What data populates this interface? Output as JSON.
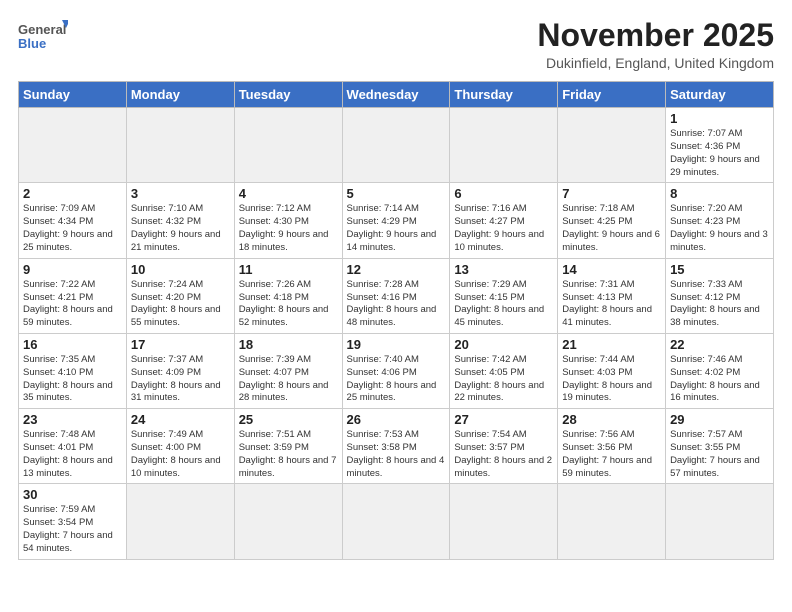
{
  "logo": {
    "line1": "General",
    "line2": "Blue"
  },
  "header": {
    "month": "November 2025",
    "location": "Dukinfield, England, United Kingdom"
  },
  "weekdays": [
    "Sunday",
    "Monday",
    "Tuesday",
    "Wednesday",
    "Thursday",
    "Friday",
    "Saturday"
  ],
  "weeks": [
    [
      {
        "day": "",
        "info": ""
      },
      {
        "day": "",
        "info": ""
      },
      {
        "day": "",
        "info": ""
      },
      {
        "day": "",
        "info": ""
      },
      {
        "day": "",
        "info": ""
      },
      {
        "day": "",
        "info": ""
      },
      {
        "day": "1",
        "info": "Sunrise: 7:07 AM\nSunset: 4:36 PM\nDaylight: 9 hours\nand 29 minutes."
      }
    ],
    [
      {
        "day": "2",
        "info": "Sunrise: 7:09 AM\nSunset: 4:34 PM\nDaylight: 9 hours\nand 25 minutes."
      },
      {
        "day": "3",
        "info": "Sunrise: 7:10 AM\nSunset: 4:32 PM\nDaylight: 9 hours\nand 21 minutes."
      },
      {
        "day": "4",
        "info": "Sunrise: 7:12 AM\nSunset: 4:30 PM\nDaylight: 9 hours\nand 18 minutes."
      },
      {
        "day": "5",
        "info": "Sunrise: 7:14 AM\nSunset: 4:29 PM\nDaylight: 9 hours\nand 14 minutes."
      },
      {
        "day": "6",
        "info": "Sunrise: 7:16 AM\nSunset: 4:27 PM\nDaylight: 9 hours\nand 10 minutes."
      },
      {
        "day": "7",
        "info": "Sunrise: 7:18 AM\nSunset: 4:25 PM\nDaylight: 9 hours\nand 6 minutes."
      },
      {
        "day": "8",
        "info": "Sunrise: 7:20 AM\nSunset: 4:23 PM\nDaylight: 9 hours\nand 3 minutes."
      }
    ],
    [
      {
        "day": "9",
        "info": "Sunrise: 7:22 AM\nSunset: 4:21 PM\nDaylight: 8 hours\nand 59 minutes."
      },
      {
        "day": "10",
        "info": "Sunrise: 7:24 AM\nSunset: 4:20 PM\nDaylight: 8 hours\nand 55 minutes."
      },
      {
        "day": "11",
        "info": "Sunrise: 7:26 AM\nSunset: 4:18 PM\nDaylight: 8 hours\nand 52 minutes."
      },
      {
        "day": "12",
        "info": "Sunrise: 7:28 AM\nSunset: 4:16 PM\nDaylight: 8 hours\nand 48 minutes."
      },
      {
        "day": "13",
        "info": "Sunrise: 7:29 AM\nSunset: 4:15 PM\nDaylight: 8 hours\nand 45 minutes."
      },
      {
        "day": "14",
        "info": "Sunrise: 7:31 AM\nSunset: 4:13 PM\nDaylight: 8 hours\nand 41 minutes."
      },
      {
        "day": "15",
        "info": "Sunrise: 7:33 AM\nSunset: 4:12 PM\nDaylight: 8 hours\nand 38 minutes."
      }
    ],
    [
      {
        "day": "16",
        "info": "Sunrise: 7:35 AM\nSunset: 4:10 PM\nDaylight: 8 hours\nand 35 minutes."
      },
      {
        "day": "17",
        "info": "Sunrise: 7:37 AM\nSunset: 4:09 PM\nDaylight: 8 hours\nand 31 minutes."
      },
      {
        "day": "18",
        "info": "Sunrise: 7:39 AM\nSunset: 4:07 PM\nDaylight: 8 hours\nand 28 minutes."
      },
      {
        "day": "19",
        "info": "Sunrise: 7:40 AM\nSunset: 4:06 PM\nDaylight: 8 hours\nand 25 minutes."
      },
      {
        "day": "20",
        "info": "Sunrise: 7:42 AM\nSunset: 4:05 PM\nDaylight: 8 hours\nand 22 minutes."
      },
      {
        "day": "21",
        "info": "Sunrise: 7:44 AM\nSunset: 4:03 PM\nDaylight: 8 hours\nand 19 minutes."
      },
      {
        "day": "22",
        "info": "Sunrise: 7:46 AM\nSunset: 4:02 PM\nDaylight: 8 hours\nand 16 minutes."
      }
    ],
    [
      {
        "day": "23",
        "info": "Sunrise: 7:48 AM\nSunset: 4:01 PM\nDaylight: 8 hours\nand 13 minutes."
      },
      {
        "day": "24",
        "info": "Sunrise: 7:49 AM\nSunset: 4:00 PM\nDaylight: 8 hours\nand 10 minutes."
      },
      {
        "day": "25",
        "info": "Sunrise: 7:51 AM\nSunset: 3:59 PM\nDaylight: 8 hours\nand 7 minutes."
      },
      {
        "day": "26",
        "info": "Sunrise: 7:53 AM\nSunset: 3:58 PM\nDaylight: 8 hours\nand 4 minutes."
      },
      {
        "day": "27",
        "info": "Sunrise: 7:54 AM\nSunset: 3:57 PM\nDaylight: 8 hours\nand 2 minutes."
      },
      {
        "day": "28",
        "info": "Sunrise: 7:56 AM\nSunset: 3:56 PM\nDaylight: 7 hours\nand 59 minutes."
      },
      {
        "day": "29",
        "info": "Sunrise: 7:57 AM\nSunset: 3:55 PM\nDaylight: 7 hours\nand 57 minutes."
      }
    ],
    [
      {
        "day": "30",
        "info": "Sunrise: 7:59 AM\nSunset: 3:54 PM\nDaylight: 7 hours\nand 54 minutes."
      },
      {
        "day": "",
        "info": ""
      },
      {
        "day": "",
        "info": ""
      },
      {
        "day": "",
        "info": ""
      },
      {
        "day": "",
        "info": ""
      },
      {
        "day": "",
        "info": ""
      },
      {
        "day": "",
        "info": ""
      }
    ]
  ]
}
